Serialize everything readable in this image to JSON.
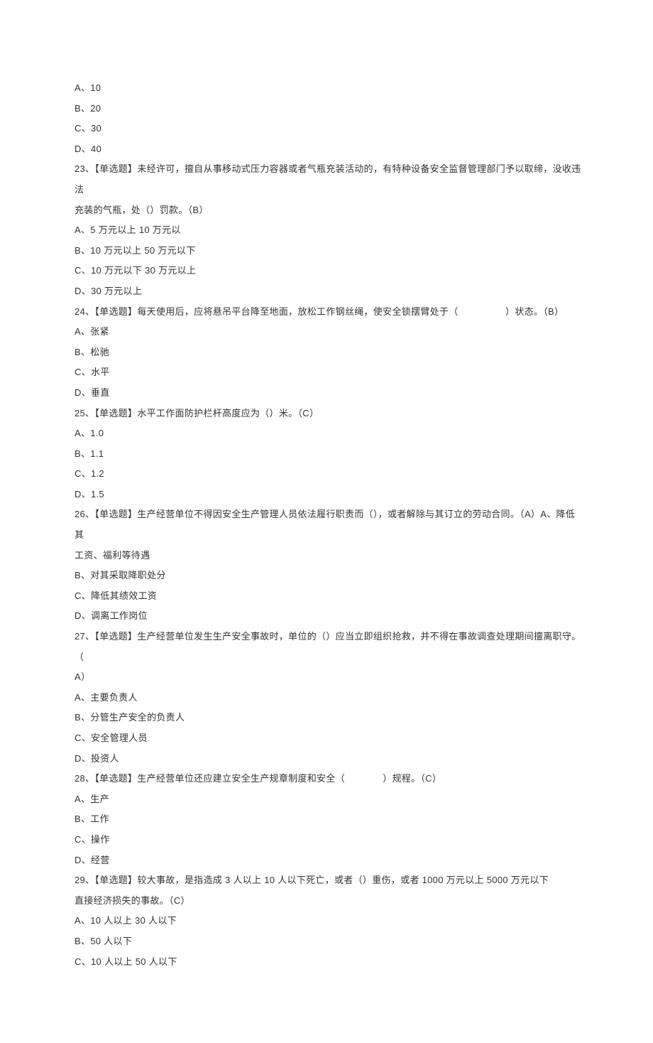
{
  "lines": [
    "A、10",
    "B、20",
    "C、30",
    "D、40",
    "23、【单选题】未经许可，擅自从事移动式压力容器或者气瓶充装活动的，有特种设备安全监督管理部门予以取缔，没收违法",
    "充装的气瓶，处（）罚款。（B）",
    "A、5 万元以上 10 万元以",
    "B、10 万元以上 50 万元以下",
    "C、10 万元以下 30 万元以上",
    "D、30 万元以上",
    "24、【单选题】每天使用后，应将悬吊平台降至地面，放松工作钢丝绳，使安全锁摆臂处于（　　　　　）状态。（B）",
    "A、张紧",
    "B、松驰",
    "C、水平",
    "D、垂直",
    "25、【单选题】水平工作面防护栏杆高度应为（）米。（C）",
    "A、1.0",
    "B、1.1",
    "C、1.2",
    "D、1.5",
    "26、【单选题】生产经营单位不得因安全生产管理人员依法履行职责而（），或者解除与其订立的劳动合同。（A）A、降低其",
    "工资、福利等待遇",
    "B、对其采取降职处分",
    "C、降低其绩效工资",
    "D、调离工作岗位",
    "27、【单选题】生产经营单位发生生产安全事故时，单位的（）应当立即组织抢救，并不得在事故调查处理期间擅离职守。（",
    "A）",
    "A、主要负责人",
    "B、分管生产安全的负责人",
    "C、安全管理人员",
    "D、投资人",
    "28、【单选题】生产经营单位还应建立安全生产规章制度和安全（　　　　）规程。（C）",
    "A、生产",
    "B、工作",
    "C、操作",
    "D、经营",
    "29、【单选题】较大事故，是指造成 3 人以上 10 人以下死亡，或者（）重伤，或者 1000 万元以上 5000 万元以下",
    "直接经济损失的事故。（C）",
    "A、10 人以上 30 人以下",
    "B、50 人以下",
    "C、10 人以上 50 人以下"
  ]
}
